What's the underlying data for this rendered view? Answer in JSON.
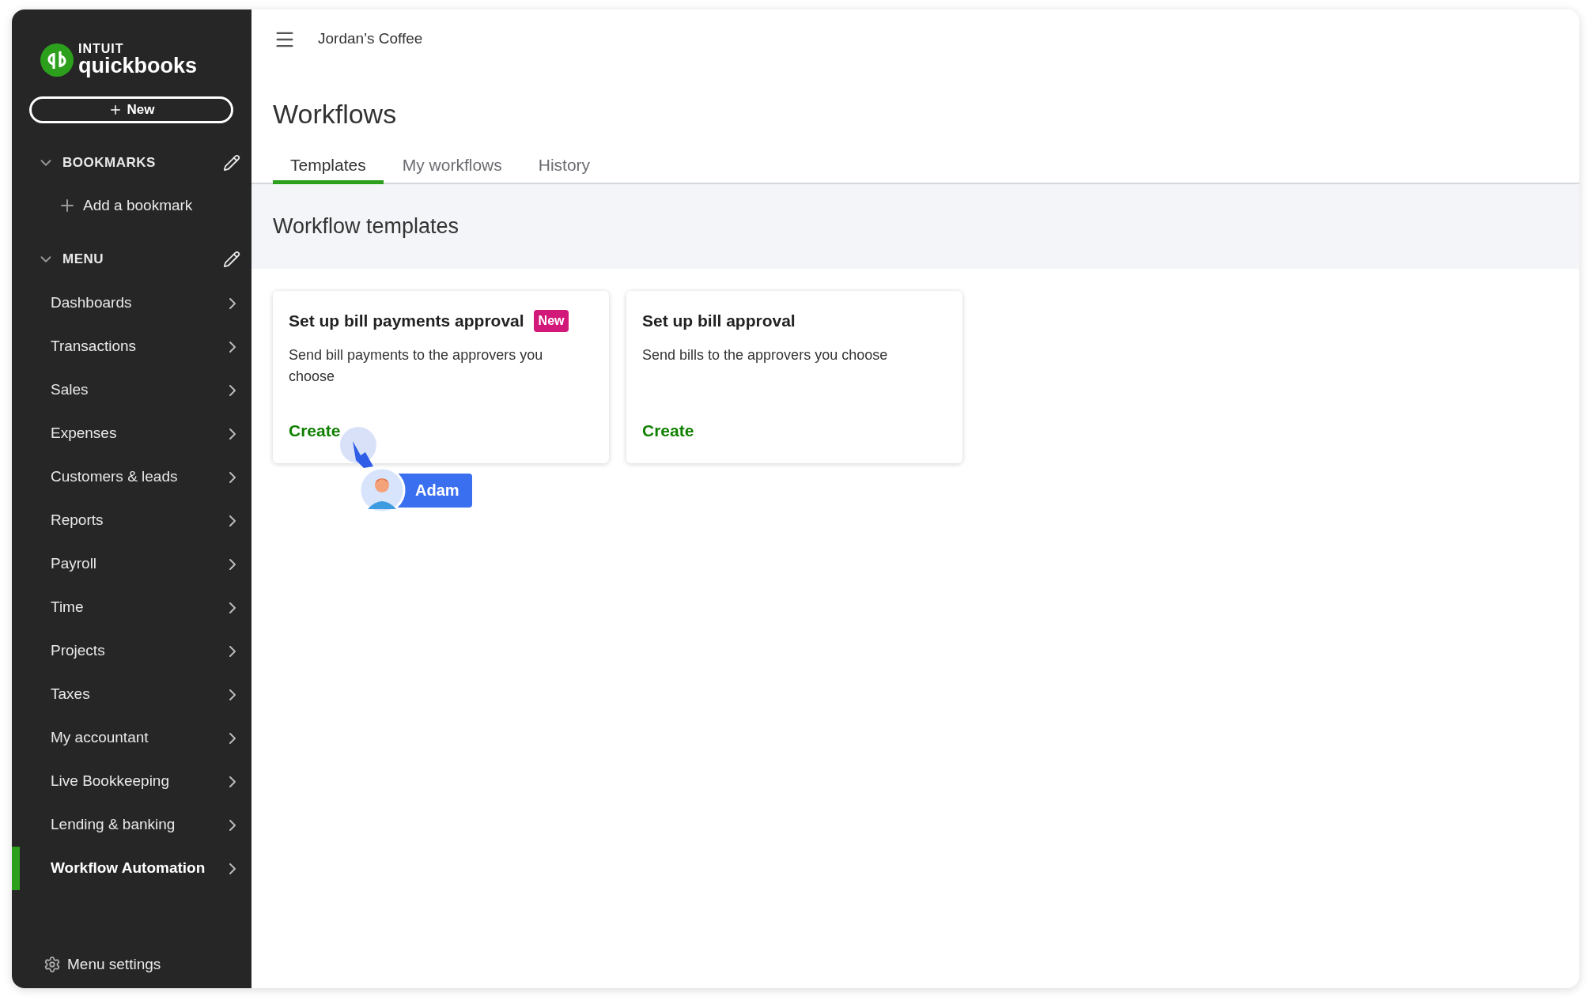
{
  "logo": {
    "top": "INTUIT",
    "bottom": "quickbooks"
  },
  "new_button": {
    "label": "New"
  },
  "bookmarks": {
    "title": "BOOKMARKS",
    "add_label": "Add a bookmark"
  },
  "menu": {
    "title": "MENU",
    "items": [
      {
        "label": "Dashboards",
        "selected": false
      },
      {
        "label": "Transactions",
        "selected": false
      },
      {
        "label": "Sales",
        "selected": false
      },
      {
        "label": "Expenses",
        "selected": false
      },
      {
        "label": "Customers & leads",
        "selected": false
      },
      {
        "label": "Reports",
        "selected": false
      },
      {
        "label": "Payroll",
        "selected": false
      },
      {
        "label": "Time",
        "selected": false
      },
      {
        "label": "Projects",
        "selected": false
      },
      {
        "label": "Taxes",
        "selected": false
      },
      {
        "label": "My accountant",
        "selected": false
      },
      {
        "label": "Live Bookkeeping",
        "selected": false
      },
      {
        "label": "Lending & banking",
        "selected": false
      },
      {
        "label": "Workflow Automation",
        "selected": true
      }
    ]
  },
  "menu_settings": {
    "label": "Menu settings"
  },
  "header": {
    "company": "Jordan’s Coffee"
  },
  "page": {
    "title": "Workflows"
  },
  "tabs": [
    {
      "label": "Templates",
      "selected": true
    },
    {
      "label": "My workflows",
      "selected": false
    },
    {
      "label": "History",
      "selected": false
    }
  ],
  "section": {
    "title": "Workflow templates"
  },
  "cards": [
    {
      "title": "Set up bill payments approval",
      "badge": "New",
      "description": "Send bill payments to the approvers you choose",
      "action": "Create"
    },
    {
      "title": "Set up bill approval",
      "description": "Send bills to the approvers you choose",
      "action": "Create"
    }
  ],
  "cursor": {
    "label": "Adam"
  }
}
